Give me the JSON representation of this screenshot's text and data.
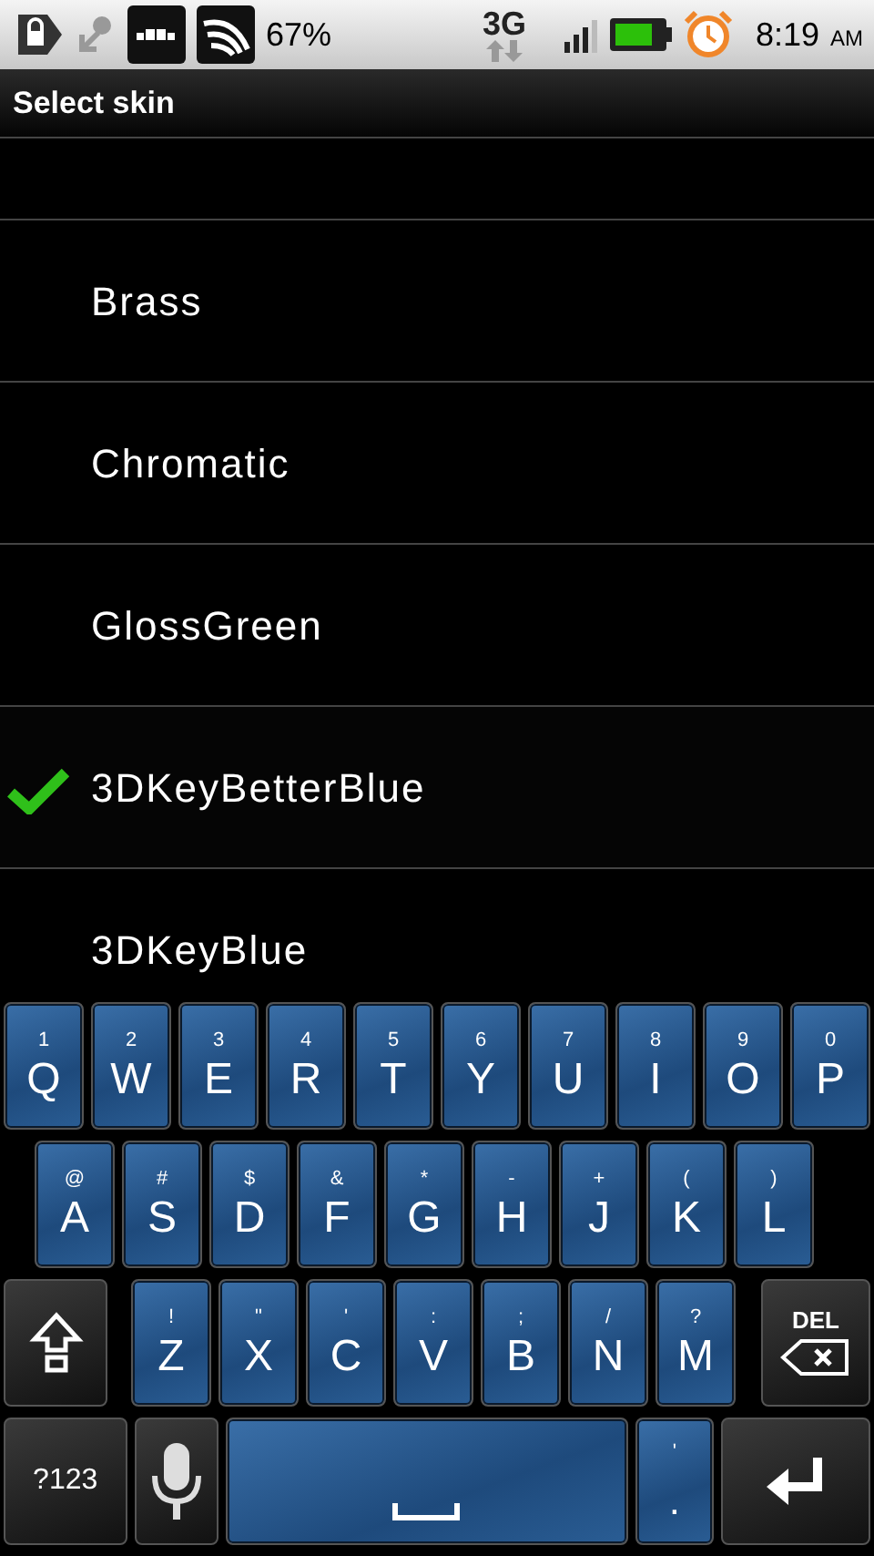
{
  "status_bar": {
    "battery_percent": "67%",
    "network": "3G",
    "time": "8:19",
    "time_suffix": "AM"
  },
  "title": "Select skin",
  "skins": [
    {
      "name": "Brass",
      "selected": false
    },
    {
      "name": "Chromatic",
      "selected": false
    },
    {
      "name": "GlossGreen",
      "selected": false
    },
    {
      "name": "3DKeyBetterBlue",
      "selected": true
    },
    {
      "name": "3DKeyBlue",
      "selected": false
    }
  ],
  "keyboard": {
    "rows": [
      {
        "keys": [
          {
            "kind": "letter",
            "label": "Q",
            "alt": "1"
          },
          {
            "kind": "letter",
            "label": "W",
            "alt": "2"
          },
          {
            "kind": "letter",
            "label": "E",
            "alt": "3"
          },
          {
            "kind": "letter",
            "label": "R",
            "alt": "4"
          },
          {
            "kind": "letter",
            "label": "T",
            "alt": "5"
          },
          {
            "kind": "letter",
            "label": "Y",
            "alt": "6"
          },
          {
            "kind": "letter",
            "label": "U",
            "alt": "7"
          },
          {
            "kind": "letter",
            "label": "I",
            "alt": "8"
          },
          {
            "kind": "letter",
            "label": "O",
            "alt": "9"
          },
          {
            "kind": "letter",
            "label": "P",
            "alt": "0"
          }
        ]
      },
      {
        "keys": [
          {
            "kind": "letter",
            "label": "A",
            "alt": "@"
          },
          {
            "kind": "letter",
            "label": "S",
            "alt": "#"
          },
          {
            "kind": "letter",
            "label": "D",
            "alt": "$"
          },
          {
            "kind": "letter",
            "label": "F",
            "alt": "&"
          },
          {
            "kind": "letter",
            "label": "G",
            "alt": "*"
          },
          {
            "kind": "letter",
            "label": "H",
            "alt": "-"
          },
          {
            "kind": "letter",
            "label": "J",
            "alt": "+"
          },
          {
            "kind": "letter",
            "label": "K",
            "alt": "("
          },
          {
            "kind": "letter",
            "label": "L",
            "alt": ")"
          }
        ]
      },
      {
        "keys": [
          {
            "kind": "shift"
          },
          {
            "kind": "letter",
            "label": "Z",
            "alt": "!"
          },
          {
            "kind": "letter",
            "label": "X",
            "alt": "\""
          },
          {
            "kind": "letter",
            "label": "C",
            "alt": "'"
          },
          {
            "kind": "letter",
            "label": "V",
            "alt": ":"
          },
          {
            "kind": "letter",
            "label": "B",
            "alt": ";"
          },
          {
            "kind": "letter",
            "label": "N",
            "alt": "/"
          },
          {
            "kind": "letter",
            "label": "M",
            "alt": "?"
          },
          {
            "kind": "delete",
            "label": "DEL"
          }
        ]
      },
      {
        "keys": [
          {
            "kind": "symbols",
            "label": "?123"
          },
          {
            "kind": "mic"
          },
          {
            "kind": "space"
          },
          {
            "kind": "period",
            "label": ".",
            "alt": "'"
          },
          {
            "kind": "enter"
          }
        ]
      }
    ]
  }
}
